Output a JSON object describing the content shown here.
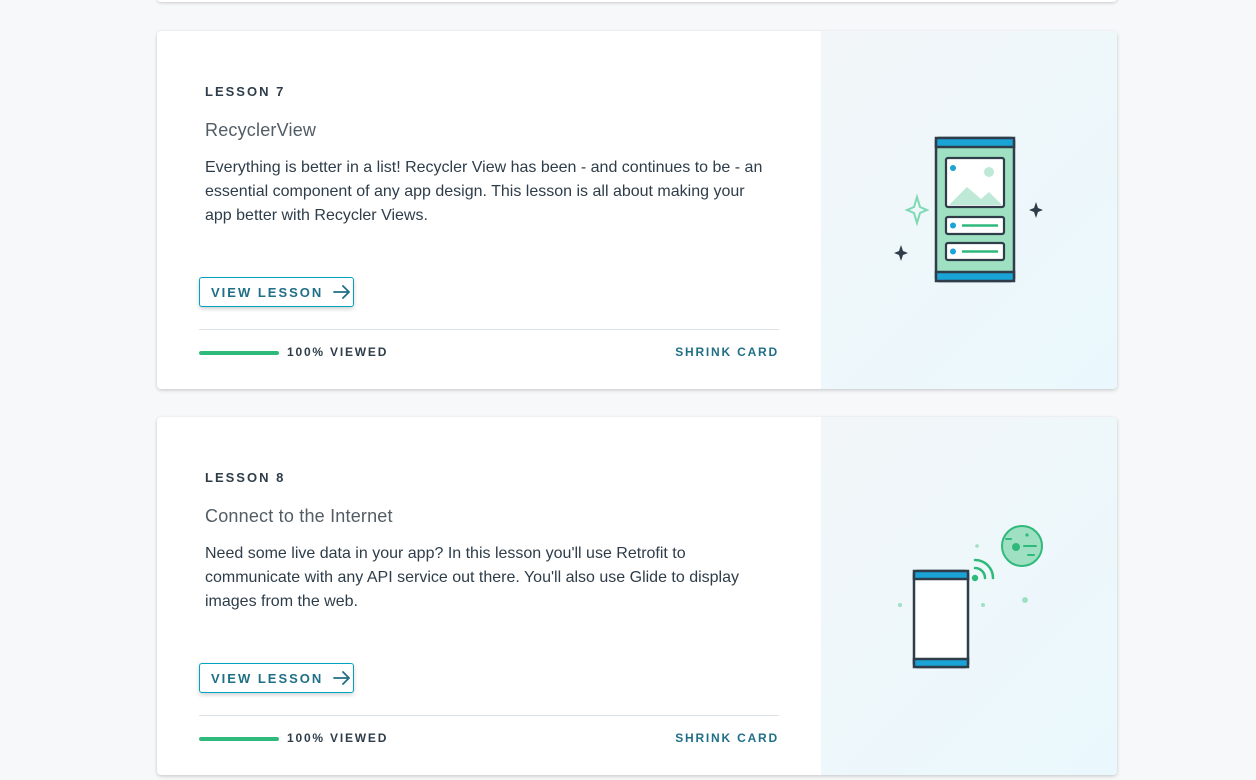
{
  "lessons": [
    {
      "number_label": "LESSON 7",
      "title": "RecyclerView",
      "description": "Everything is better in a list! Recycler View has been - and continues to be - an essential component of any app design. This lesson is all about making your app better with Recycler Views.",
      "view_button_label": "VIEW LESSON",
      "progress_percent": 100,
      "progress_label": "100% VIEWED",
      "shrink_label": "SHRINK CARD",
      "illustration_icon": "phone-list-icon"
    },
    {
      "number_label": "LESSON 8",
      "title": "Connect to the Internet",
      "description": "Need some live data in your app? In this lesson you'll use Retrofit to communicate with any API service out there. You'll also use Glide to display images from the web.",
      "view_button_label": "VIEW LESSON",
      "progress_percent": 100,
      "progress_label": "100% VIEWED",
      "shrink_label": "SHRINK CARD",
      "illustration_icon": "phone-network-icon"
    }
  ],
  "colors": {
    "accent": "#02a3bf",
    "button_text": "#1f6f87",
    "progress": "#2fb97a",
    "heading": "#2e3d49"
  }
}
